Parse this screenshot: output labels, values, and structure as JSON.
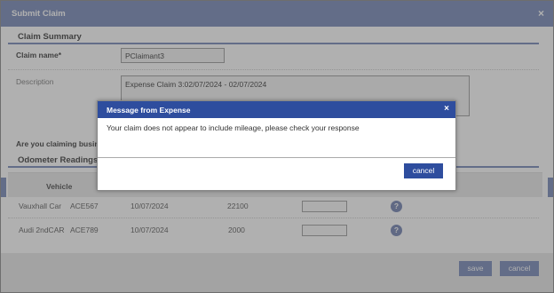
{
  "outer": {
    "title": "Submit Claim",
    "close": "×"
  },
  "claim_summary": {
    "title": "Claim Summary",
    "claim_name_label": "Claim name*",
    "claim_name_value": "PClaimant3",
    "description_label": "Description",
    "description_value": "Expense Claim 3:02/07/2024 - 02/07/2024",
    "mileage_question": "Are you claiming busine"
  },
  "odometer": {
    "title": "Odometer Readings",
    "column_vehicle": "Vehicle",
    "rows": [
      {
        "vehicle": "Vauxhall Car",
        "reg": "ACE567",
        "date": "10/07/2024",
        "reading": "22100"
      },
      {
        "vehicle": "Audi 2ndCAR",
        "reg": "ACE789",
        "date": "10/07/2024",
        "reading": "2000"
      }
    ],
    "help_glyph": "?"
  },
  "footer": {
    "save": "save",
    "cancel": "cancel"
  },
  "dialog": {
    "title": "Message from Expense",
    "close": "×",
    "message": "Your claim does not appear to include mileage, please check your response",
    "cancel": "cancel"
  }
}
